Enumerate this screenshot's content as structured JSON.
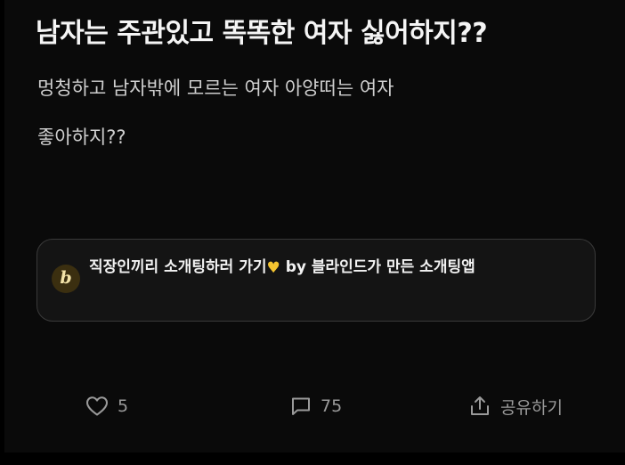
{
  "post": {
    "title": "남자는 주관있고 똑똑한 여자 싫어하지??",
    "body_lines": [
      "멍청하고 남자밖에 모르는 여자 아양떠는 여자",
      "좋아하지??"
    ]
  },
  "ad": {
    "logo_letter": "b",
    "text_prefix": "직장인끼리 소개팅하러 가기",
    "emoji": "♥",
    "text_suffix": " by 블라인드가 만든 소개팅앱"
  },
  "actions": {
    "like_count": "5",
    "comment_count": "75",
    "share_label": "공유하기"
  },
  "icons": {
    "like": "heart-outline-icon",
    "comment": "speech-bubble-icon",
    "share": "share-upload-icon"
  },
  "colors": {
    "background": "#0a0a0a",
    "card_border": "#3a3a3a",
    "muted_text": "#9a9a9a",
    "heart_emoji": "#f4c430"
  }
}
